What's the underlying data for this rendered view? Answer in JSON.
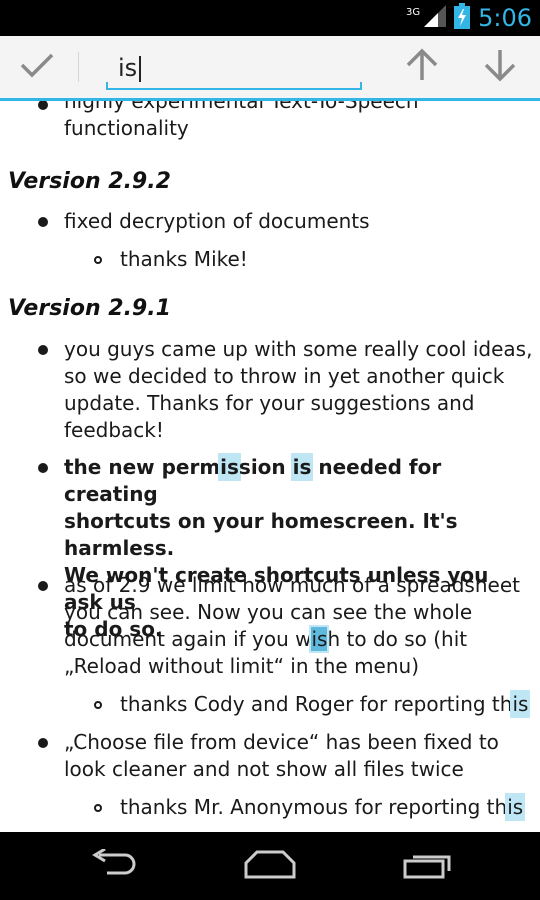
{
  "status_bar": {
    "network": "3G",
    "time": "5:06"
  },
  "find_bar": {
    "query": "is",
    "done_icon": "checkmark-icon",
    "prev_icon": "arrow-up-icon",
    "next_icon": "arrow-down-icon"
  },
  "content": {
    "partial_item": {
      "line1": "highly experimental Text-To-Speech",
      "line2": "functionality"
    },
    "v292": {
      "heading": "Version 2.9.2",
      "item1": "fixed decryption of documents",
      "sub1": "thanks Mike!"
    },
    "v291": {
      "heading": "Version 2.9.1",
      "item1": {
        "l1": "you guys came up with some really cool ideas,",
        "l2": "so we decided to throw in yet another quick",
        "l3": "update. Thanks for your suggestions and",
        "l4": "feedback!"
      },
      "item2": {
        "l1a": "the new perm",
        "l1b": "is",
        "l1c": "sion ",
        "l1d": "is",
        "l1e": " needed for creating",
        "l2": "shortcuts on your homescreen. It's harmless.",
        "l3": "We won't create shortcuts unless you ask us",
        "l4": "to do so."
      },
      "item3": {
        "l1": "as of 2.9 we limit how much of a spreadsheet",
        "l2": "you can see. Now you can see the whole",
        "l3a": "document again if you w",
        "l3b": "is",
        "l3c": "h to do so (hit",
        "l4": "„Reload without limit“ in the menu)"
      },
      "sub3": {
        "a": "thanks Cody and Roger for reporting th",
        "b": "is"
      },
      "item4": {
        "l1": "„Choose file from device“ has been fixed to",
        "l2": "look cleaner and not show all files twice"
      },
      "sub4": {
        "a": "thanks Mr. Anonymous for reporting th",
        "b": "is"
      }
    }
  },
  "nav_bar": {
    "back_icon": "back-icon",
    "home_icon": "home-icon",
    "recents_icon": "recent-apps-icon"
  },
  "colors": {
    "accent": "#33b5e5",
    "highlight": "#bfe6f5",
    "highlight_current": "#5fb9dd"
  }
}
